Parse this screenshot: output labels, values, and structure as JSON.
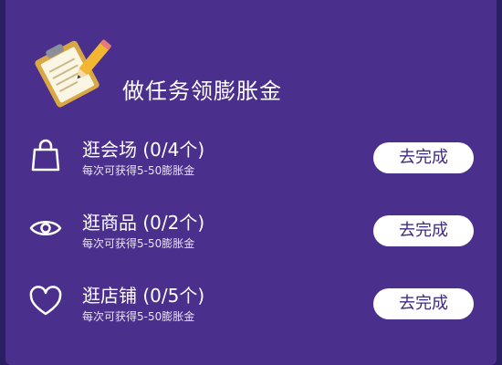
{
  "header": {
    "title": "做任务领膨胀金",
    "icon": "clipboard-pencil-icon"
  },
  "tasks": [
    {
      "name": "逛会场 (0/4个)",
      "subtitle": "每次可获得5-50膨胀金",
      "button": "去完成",
      "icon": "shopping-bag-icon"
    },
    {
      "name": "逛商品 (0/2个)",
      "subtitle": "每次可获得5-50膨胀金",
      "button": "去完成",
      "icon": "eye-icon"
    },
    {
      "name": "逛店铺 (0/5个)",
      "subtitle": "每次可获得5-50膨胀金",
      "button": "去完成",
      "icon": "heart-icon"
    }
  ],
  "colors": {
    "panel": "#4a2f8c",
    "background": "#2a1f63",
    "button_text": "#3f2a86"
  }
}
